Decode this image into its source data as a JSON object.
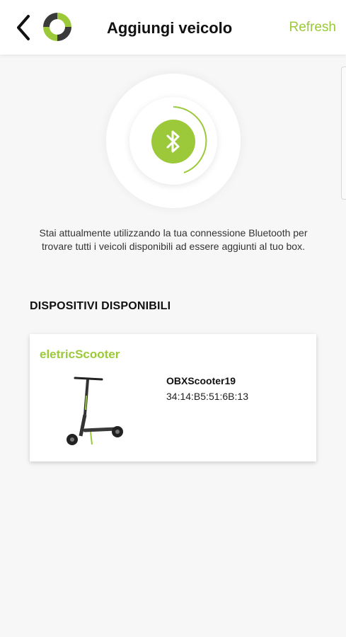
{
  "header": {
    "title": "Aggiungi veicolo",
    "refresh_label": "Refresh",
    "back_icon": "chevron-left-icon",
    "logo_icon": "brand-logo"
  },
  "scan": {
    "icon": "bluetooth-icon",
    "description": "Stai attualmente utilizzando la tua connessione Bluetooth per trovare tutti i veicoli disponibili ad essere aggiunti al tuo box."
  },
  "devices_section": {
    "title": "DISPOSITIVI DISPONIBILI",
    "devices": [
      {
        "type": "eletricScooter",
        "name": "OBXScooter19",
        "mac": "34:14:B5:51:6B:13",
        "image_icon": "scooter-image"
      }
    ]
  },
  "colors": {
    "accent": "#9cc93a",
    "background": "#f7f7f7",
    "card": "#ffffff"
  }
}
